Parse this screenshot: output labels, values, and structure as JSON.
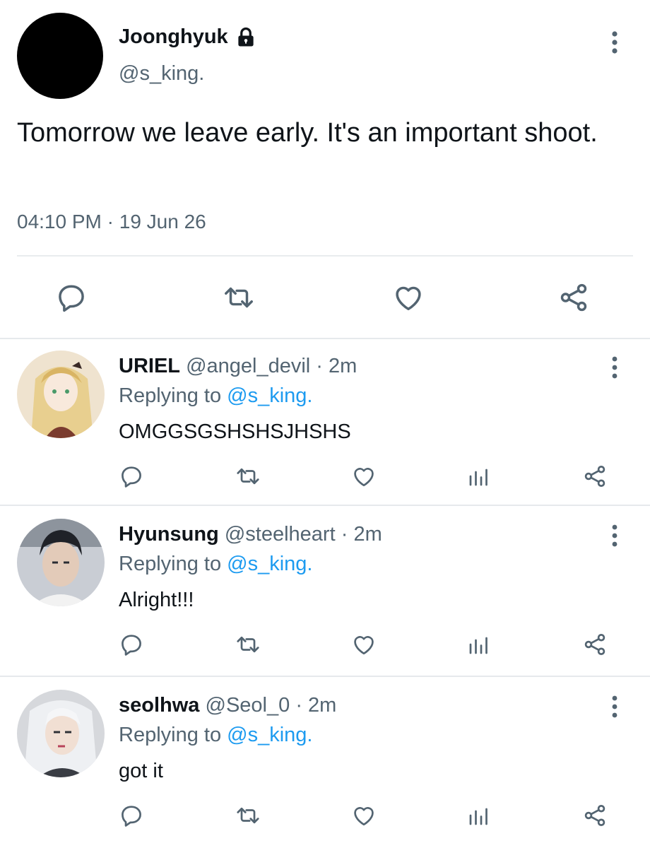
{
  "main_tweet": {
    "name": "Joonghyuk",
    "handle": "@s_king.",
    "text": "Tomorrow we leave early. It's an important shoot.",
    "time": "04:10 PM",
    "separator": "·",
    "date": "19 Jun 26",
    "icons": [
      "lock-icon",
      "more-vertical-icon",
      "reply-icon",
      "retweet-icon",
      "like-icon",
      "share-icon"
    ]
  },
  "replies": [
    {
      "name": "URIEL",
      "handle": "@angel_devil",
      "sep": "·",
      "time": "2m",
      "replying_prefix": "Replying to",
      "replying_to": "@s_king.",
      "text": "OMGGSGSHSHSJHSHS",
      "avatar_colors": [
        "#f6e3b4",
        "#c9a65a",
        "#7a3b2e"
      ]
    },
    {
      "name": "Hyunsung",
      "handle": "@steelheart",
      "sep": "·",
      "time": "2m",
      "replying_prefix": "Replying to",
      "replying_to": "@s_king.",
      "text": "Alright!!!",
      "avatar_colors": [
        "#2a2d33",
        "#d9c3b3",
        "#9aa3ad"
      ]
    },
    {
      "name": "seolhwa",
      "handle": "@Seol_0",
      "sep": "·",
      "time": "2m",
      "replying_prefix": "Replying to",
      "replying_to": "@s_king.",
      "text": "got it",
      "avatar_colors": [
        "#e9eaee",
        "#b8bcc4",
        "#3a3d44"
      ]
    }
  ],
  "colors": {
    "accent": "#1d9bf0",
    "secondary_text": "#536471",
    "divider": "#e6e9ec"
  }
}
